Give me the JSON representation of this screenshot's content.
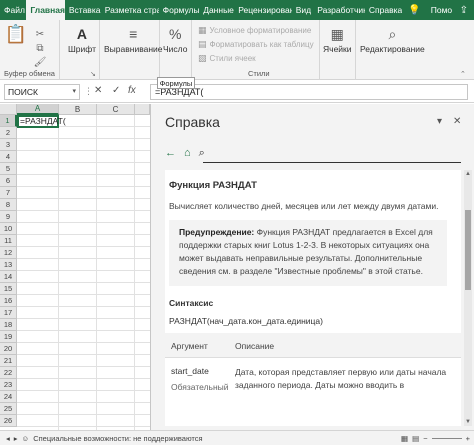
{
  "tabs": [
    {
      "label": "Файл",
      "active": false
    },
    {
      "label": "Главная",
      "active": true
    },
    {
      "label": "Вставка",
      "active": false
    },
    {
      "label": "Разметка стра",
      "active": false
    },
    {
      "label": "Формулы",
      "active": false
    },
    {
      "label": "Данные",
      "active": false
    },
    {
      "label": "Рецензирован",
      "active": false
    },
    {
      "label": "Вид",
      "active": false
    },
    {
      "label": "Разработчик",
      "active": false
    },
    {
      "label": "Справка",
      "active": false
    }
  ],
  "tab_search_label": "Помо",
  "ribbon": {
    "clipboard_label": "Буфер обмена",
    "font_label": "Шрифт",
    "alignment_label": "Выравнивание",
    "number_label": "Число",
    "cond_format": "Условное форматирование",
    "format_table": "Форматировать как таблицу",
    "cell_styles": "Стили ячеек",
    "styles_label": "Стили",
    "cells_label": "Ячейки",
    "editing_label": "Редактирование"
  },
  "formula_bar": {
    "name_box": "ПОИСК",
    "formula": "=РАЗНДАТ(",
    "tooltip": "Формулы"
  },
  "grid": {
    "columns": [
      "A",
      "B",
      "C"
    ],
    "rows": [
      "1",
      "2",
      "3",
      "4",
      "5",
      "6",
      "7",
      "8",
      "9",
      "10",
      "11",
      "12",
      "13",
      "14",
      "15",
      "16",
      "17",
      "18",
      "19",
      "20",
      "21",
      "22",
      "23",
      "24",
      "25",
      "26"
    ],
    "active_cell_text": "=РАЗНДАТ("
  },
  "help": {
    "pane_title": "Справка",
    "func_title": "Функция РАЗНДАТ",
    "func_desc": "Вычисляет количество дней, месяцев или лет между двумя датами.",
    "warn_bold": "Предупреждение:",
    "warn_text": " Функция РАЗНДАТ предлагается в Excel для поддержки старых книг Lotus 1-2-3. В некоторых ситуациях она может выдавать неправильные результаты. Дополнительные сведения см. в разделе \"Известные проблемы\" в этой статье.",
    "syntax_label": "Синтаксис",
    "syntax": "РАЗНДАТ(нач_дата.кон_дата.единица)",
    "col_arg": "Аргумент",
    "col_desc": "Описание",
    "arg_name": "start_date",
    "arg_req": "Обязательный",
    "arg_desc": "Дата, которая представляет первую или даты начала заданного периода. Даты можно вводить в"
  },
  "status": {
    "accessibility": "Специальные возможности: не поддерживаются"
  },
  "colors": {
    "accent": "#217346"
  }
}
